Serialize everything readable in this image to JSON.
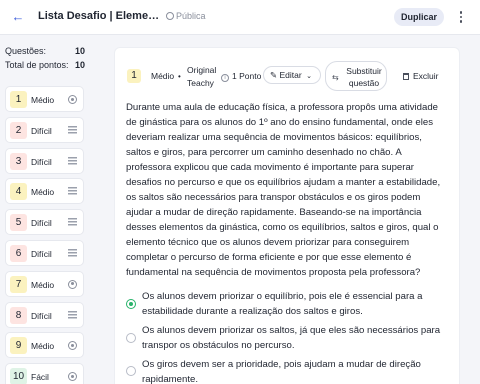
{
  "header": {
    "title": "Lista Desafio | Elementos B...",
    "visibility": "Pública",
    "duplicate_label": "Duplicar"
  },
  "sidebar": {
    "questions_label": "Questões:",
    "questions_count": "10",
    "points_label": "Total de pontos:",
    "points_count": "10",
    "items": [
      {
        "num": "1",
        "label": "Médio",
        "icon": "radio-icon",
        "color": "#fbf2bf"
      },
      {
        "num": "2",
        "label": "Difícil",
        "icon": "lines-icon",
        "color": "#fde4e1"
      },
      {
        "num": "3",
        "label": "Difícil",
        "icon": "lines-icon",
        "color": "#fde4e1"
      },
      {
        "num": "4",
        "label": "Médio",
        "icon": "lines-icon",
        "color": "#fbf2bf"
      },
      {
        "num": "5",
        "label": "Difícil",
        "icon": "lines-icon",
        "color": "#fde4e1"
      },
      {
        "num": "6",
        "label": "Difícil",
        "icon": "lines-icon",
        "color": "#fde4e1"
      },
      {
        "num": "7",
        "label": "Médio",
        "icon": "radio-icon",
        "color": "#fbf2bf"
      },
      {
        "num": "8",
        "label": "Difícil",
        "icon": "lines-icon",
        "color": "#fde4e1"
      },
      {
        "num": "9",
        "label": "Médio",
        "icon": "radio-icon",
        "color": "#fbf2bf"
      },
      {
        "num": "10",
        "label": "Fácil",
        "icon": "radio-icon",
        "color": "#dff3e6"
      }
    ]
  },
  "question": {
    "number": "1",
    "difficulty": "Médio",
    "source": "Original Teachy",
    "points": "1 Ponto",
    "edit_label": "Editar",
    "replace_label": "Substituir questão",
    "delete_label": "Excluir",
    "statement": "Durante uma aula de educação física, a professora propôs uma atividade de ginástica para os alunos do 1º ano do ensino fundamental, onde eles deveriam realizar uma sequência de movimentos básicos: equilíbrios, saltos e giros, para percorrer um caminho desenhado no chão. A professora explicou que cada movimento é importante para superar desafios no percurso e que os equilíbrios ajudam a manter a estabilidade, os saltos são necessários para transpor obstáculos e os giros podem ajudar a mudar de direção rapidamente. Baseando-se na importância desses elementos da ginástica, como os equilíbrios, saltos e giros, qual o elemento técnico que os alunos devem priorizar para conseguirem completar o percurso de forma eficiente e por que esse elemento é fundamental na sequência de movimentos proposta pela professora?",
    "options": [
      {
        "text": "Os alunos devem priorizar o equilíbrio, pois ele é essencial para a estabilidade durante a realização dos saltos e giros.",
        "selected": true
      },
      {
        "text": "Os alunos devem priorizar os saltos, já que eles são necessários para transpor os obstáculos no percurso.",
        "selected": false
      },
      {
        "text": "Os giros devem ser a prioridade, pois ajudam a mudar de direção rapidamente.",
        "selected": false
      }
    ]
  },
  "colors": {
    "accent": "#3b5bdb",
    "correct": "#29b36b"
  }
}
